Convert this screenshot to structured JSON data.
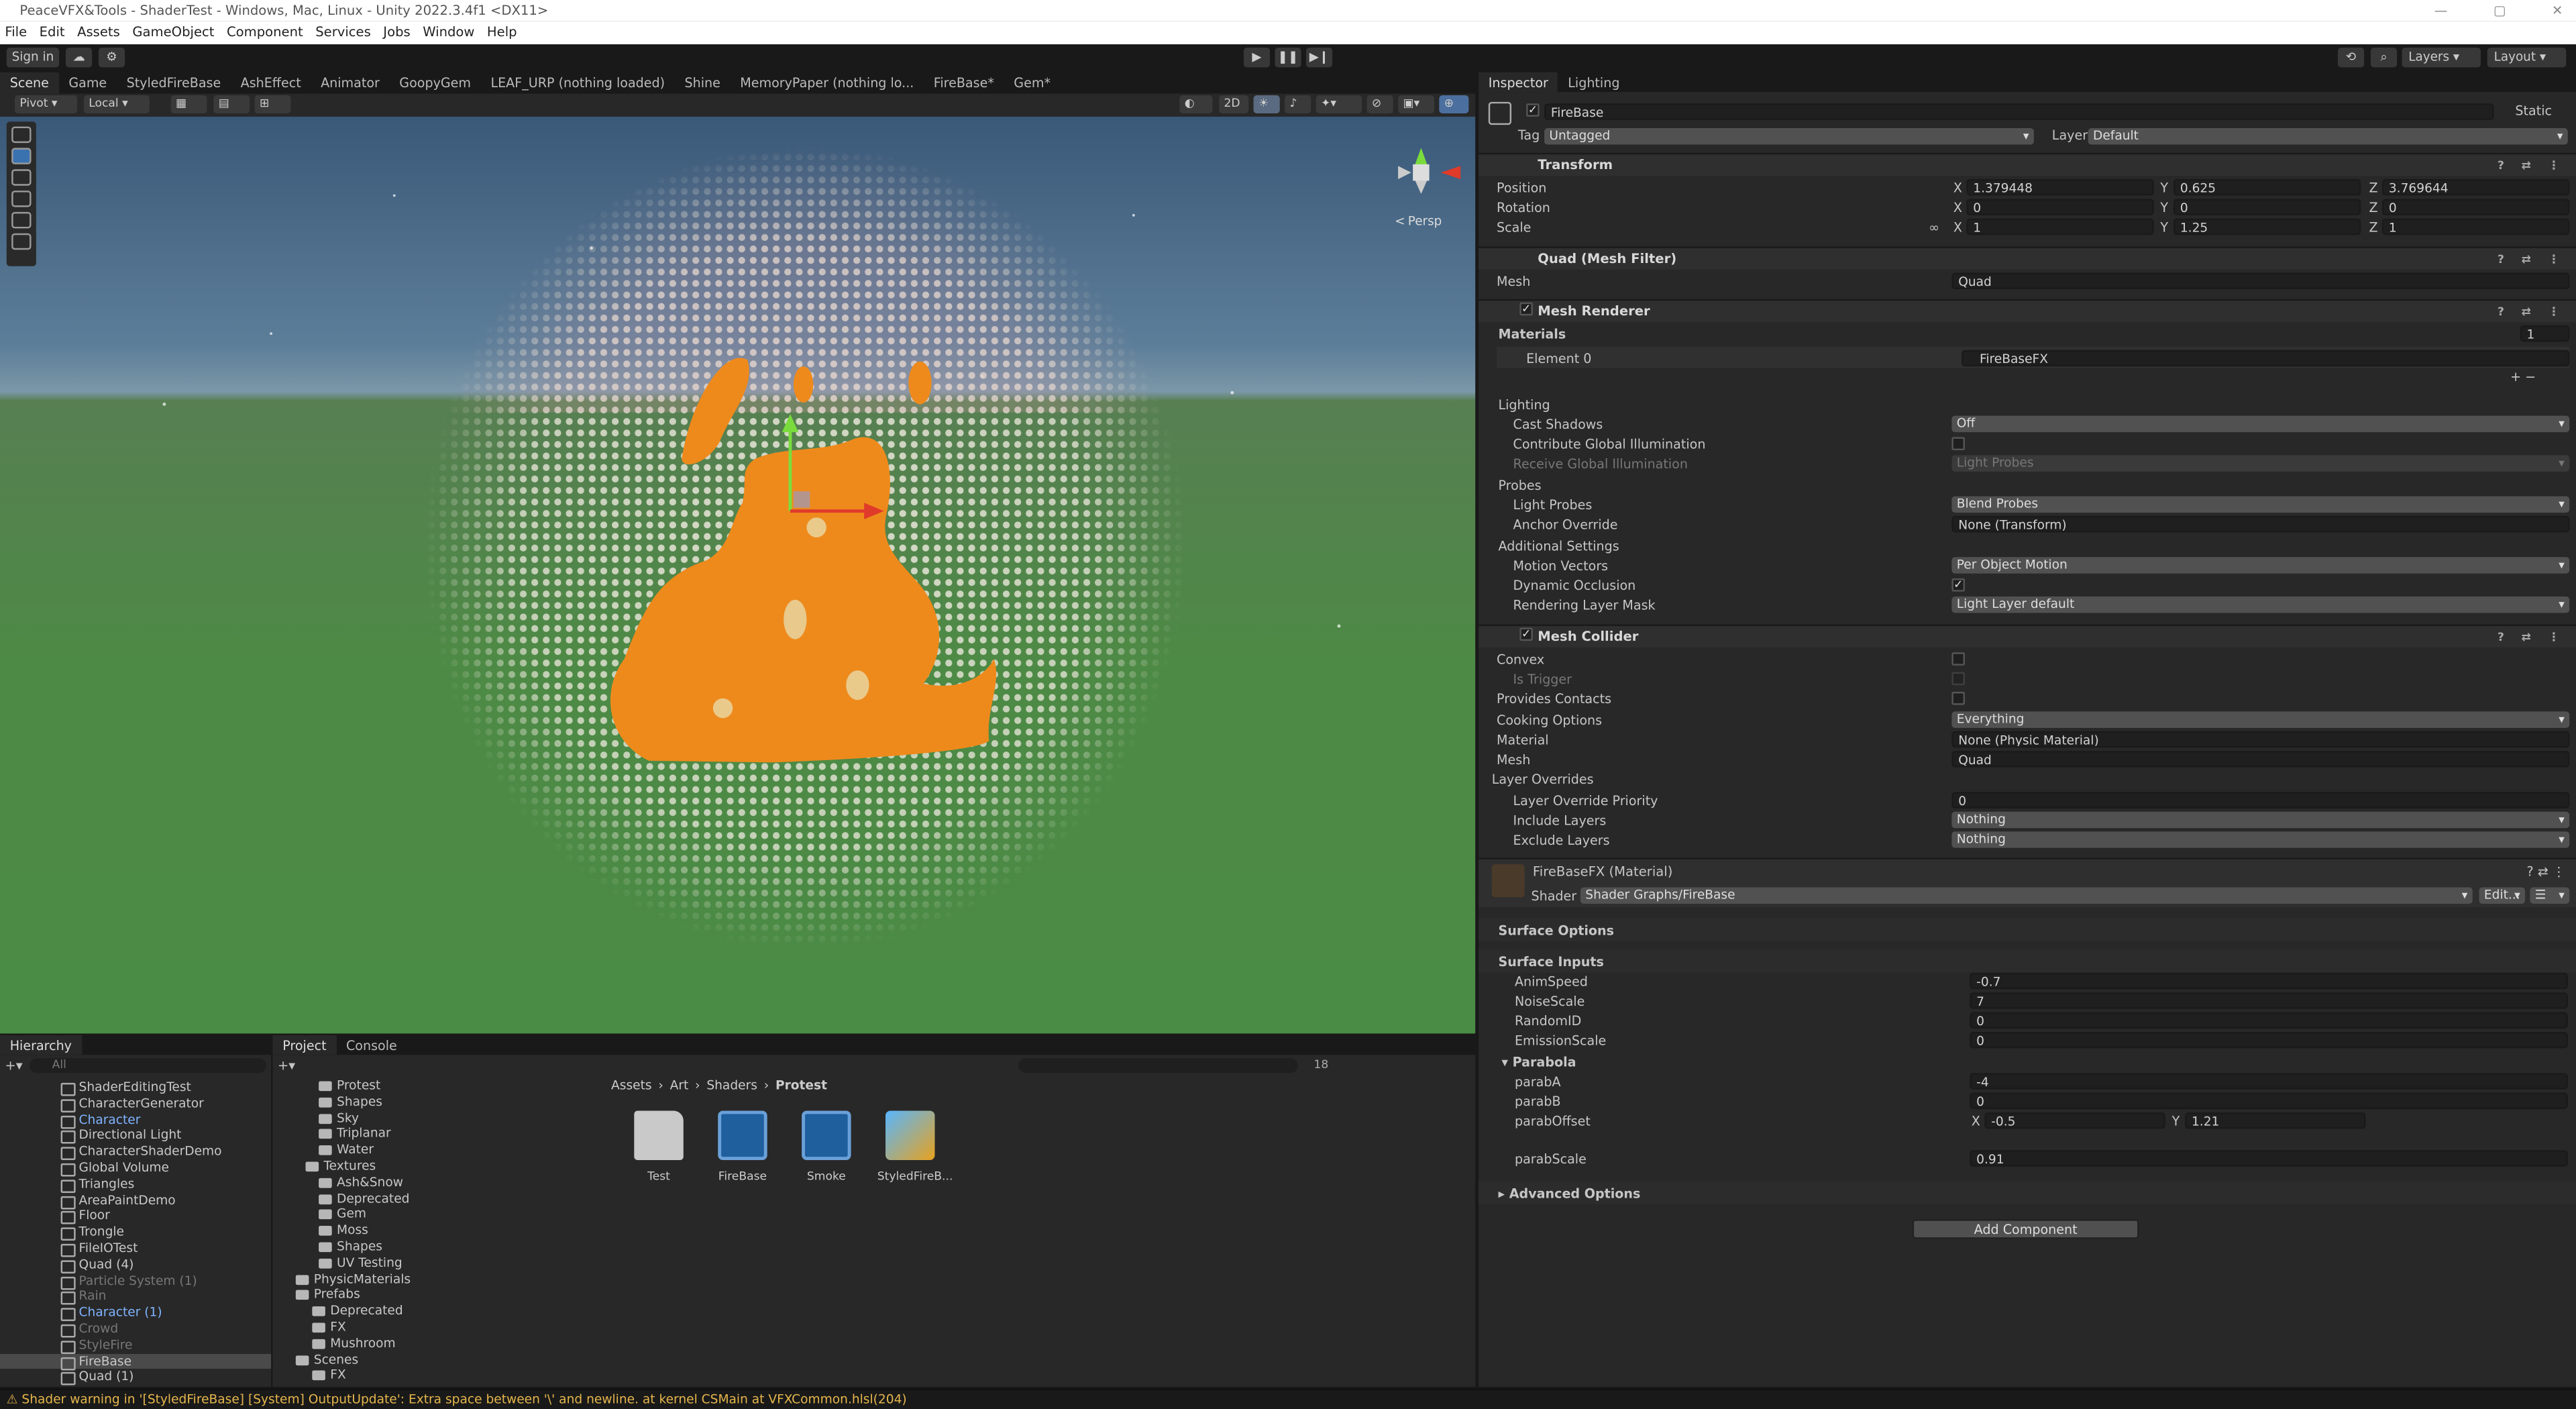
{
  "window": {
    "title": "PeaceVFX&Tools - ShaderTest - Windows, Mac, Linux - Unity 2022.3.4f1 <DX11>"
  },
  "menu": [
    "File",
    "Edit",
    "Assets",
    "GameObject",
    "Component",
    "Services",
    "Jobs",
    "Window",
    "Help"
  ],
  "toolbar": {
    "signin": "Sign in",
    "layers": "Layers",
    "layout": "Layout"
  },
  "scene_tabs": [
    "Scene",
    "Game",
    "StyledFireBase",
    "AshEffect",
    "Animator",
    "GoopyGem",
    "LEAF_URP (nothing loaded)",
    "Shine",
    "MemoryPaper (nothing lo...",
    "FireBase*",
    "Gem*"
  ],
  "scene_tools": {
    "pivot": "Pivot",
    "local": "Local",
    "twod": "2D",
    "persp": "Persp"
  },
  "hierarchy": {
    "title": "Hierarchy",
    "search_placeholder": "All",
    "items": [
      {
        "label": "ShaderEditingTest",
        "style": ""
      },
      {
        "label": "CharacterGenerator",
        "style": ""
      },
      {
        "label": "Character",
        "style": "blue"
      },
      {
        "label": "Directional Light",
        "style": ""
      },
      {
        "label": "CharacterShaderDemo",
        "style": ""
      },
      {
        "label": "Global Volume",
        "style": ""
      },
      {
        "label": "Triangles",
        "style": ""
      },
      {
        "label": "AreaPaintDemo",
        "style": ""
      },
      {
        "label": "Floor",
        "style": ""
      },
      {
        "label": "Trongle",
        "style": ""
      },
      {
        "label": "FileIOTest",
        "style": ""
      },
      {
        "label": "Quad (4)",
        "style": ""
      },
      {
        "label": "Particle System (1)",
        "style": "dim"
      },
      {
        "label": "Rain",
        "style": "dim"
      },
      {
        "label": "Character (1)",
        "style": "blue"
      },
      {
        "label": "Crowd",
        "style": "dim"
      },
      {
        "label": "StyleFire",
        "style": "dim"
      },
      {
        "label": "FireBase",
        "style": "sel"
      },
      {
        "label": "Quad (1)",
        "style": ""
      }
    ]
  },
  "project": {
    "tabs": [
      "Project",
      "Console"
    ],
    "hidden_count": "18",
    "tree": [
      {
        "label": "Protest",
        "indent": 28
      },
      {
        "label": "Shapes",
        "indent": 28
      },
      {
        "label": "Sky",
        "indent": 28
      },
      {
        "label": "Triplanar",
        "indent": 28
      },
      {
        "label": "Water",
        "indent": 28
      },
      {
        "label": "Textures",
        "indent": 20
      },
      {
        "label": "Ash&Snow",
        "indent": 28
      },
      {
        "label": "Deprecated",
        "indent": 28
      },
      {
        "label": "Gem",
        "indent": 28
      },
      {
        "label": "Moss",
        "indent": 28
      },
      {
        "label": "Shapes",
        "indent": 28
      },
      {
        "label": "UV Testing",
        "indent": 28
      },
      {
        "label": "PhysicMaterials",
        "indent": 14
      },
      {
        "label": "Prefabs",
        "indent": 14
      },
      {
        "label": "Deprecated",
        "indent": 24
      },
      {
        "label": "FX",
        "indent": 24
      },
      {
        "label": "Mushroom",
        "indent": 24
      },
      {
        "label": "Scenes",
        "indent": 14
      },
      {
        "label": "FX",
        "indent": 24
      }
    ],
    "breadcrumb": [
      "Assets",
      "Art",
      "Shaders",
      "Protest"
    ],
    "assets": [
      {
        "label": "Test",
        "kind": "folder"
      },
      {
        "label": "FireBase",
        "kind": "shader"
      },
      {
        "label": "Smoke",
        "kind": "shader"
      },
      {
        "label": "StyledFireB...",
        "kind": "vfx"
      }
    ]
  },
  "inspector": {
    "tabs": [
      "Inspector",
      "Lighting"
    ],
    "object_name": "FireBase",
    "static_label": "Static",
    "tag_label": "Tag",
    "tag_value": "Untagged",
    "layer_label": "Layer",
    "layer_value": "Default",
    "transform": {
      "title": "Transform",
      "position": {
        "label": "Position",
        "x": "1.379448",
        "y": "0.625",
        "z": "3.769644"
      },
      "rotation": {
        "label": "Rotation",
        "x": "0",
        "y": "0",
        "z": "0"
      },
      "scale": {
        "label": "Scale",
        "x": "1",
        "y": "1.25",
        "z": "1"
      }
    },
    "mesh_filter": {
      "title": "Quad (Mesh Filter)",
      "mesh_label": "Mesh",
      "mesh_value": "Quad"
    },
    "mesh_renderer": {
      "title": "Mesh Renderer",
      "materials_label": "Materials",
      "materials_count": "1",
      "element_label": "Element 0",
      "element_value": "FireBaseFX",
      "lighting": "Lighting",
      "cast_shadows_label": "Cast Shadows",
      "cast_shadows_value": "Off",
      "contribute_gi_label": "Contribute Global Illumination",
      "receive_gi_label": "Receive Global Illumination",
      "receive_gi_value": "Light Probes",
      "probes": "Probes",
      "light_probes_label": "Light Probes",
      "light_probes_value": "Blend Probes",
      "anchor_label": "Anchor Override",
      "anchor_value": "None (Transform)",
      "additional": "Additional Settings",
      "motion_label": "Motion Vectors",
      "motion_value": "Per Object Motion",
      "occlusion_label": "Dynamic Occlusion",
      "rlm_label": "Rendering Layer Mask",
      "rlm_value": "Light Layer default"
    },
    "mesh_collider": {
      "title": "Mesh Collider",
      "convex": "Convex",
      "is_trigger": "Is Trigger",
      "provides_contacts": "Provides Contacts",
      "cooking_label": "Cooking Options",
      "cooking_value": "Everything",
      "material_label": "Material",
      "material_value": "None (Physic Material)",
      "mesh_label": "Mesh",
      "mesh_value": "Quad",
      "layer_overrides": "Layer Overrides",
      "lop_label": "Layer Override Priority",
      "lop_value": "0",
      "include_label": "Include Layers",
      "include_value": "Nothing",
      "exclude_label": "Exclude Layers",
      "exclude_value": "Nothing"
    },
    "material": {
      "title": "FireBaseFX (Material)",
      "shader_label": "Shader",
      "shader_value": "Shader Graphs/FireBase",
      "edit": "Edit...",
      "surface_options": "Surface Options",
      "surface_inputs": "Surface Inputs",
      "props": [
        {
          "label": "AnimSpeed",
          "value": "-0.7"
        },
        {
          "label": "NoiseScale",
          "value": "7"
        },
        {
          "label": "RandomID",
          "value": "0"
        },
        {
          "label": "EmissionScale",
          "value": "0"
        }
      ],
      "parabola": "Parabola",
      "parabA_label": "parabA",
      "parabA_value": "-4",
      "parabB_label": "parabB",
      "parabB_value": "0",
      "offset_label": "parabOffset",
      "offset_x": "-0.5",
      "offset_y": "1.21",
      "scale_label": "parabScale",
      "scale_value": "0.91",
      "advanced": "Advanced Options"
    },
    "add_component": "Add Component"
  },
  "status": {
    "message": "Shader warning in '[StyledFireBase] [System] OutputUpdate': Extra space between '\\' and newline. at kernel CSMain at VFXCommon.hlsl(204)"
  },
  "colors": {
    "accent": "#3a72b0",
    "warning": "#e5b64c",
    "fire": "#ee8a1c"
  }
}
